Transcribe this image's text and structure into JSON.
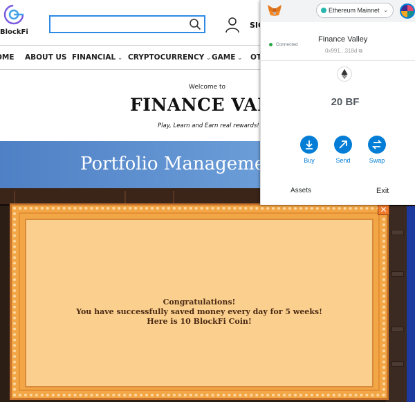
{
  "site": {
    "brand": "BlockFi",
    "search": {
      "value": "",
      "placeholder": ""
    },
    "sign_in_label": "SIG",
    "nav": [
      {
        "label": "OME",
        "chevron": false
      },
      {
        "label": "ABOUT US",
        "chevron": false
      },
      {
        "label": "FINANCIAL",
        "chevron": true
      },
      {
        "label": "CRYPTOCURRENCY",
        "chevron": true
      },
      {
        "label": "GAME",
        "chevron": true
      },
      {
        "label": "OT",
        "chevron": false
      }
    ],
    "welcome": "Welcome to",
    "title": "FINANCE VALL",
    "tagline": "Play, Learn and Earn real rewards!",
    "banner": "Portfolio Manageme"
  },
  "game": {
    "popup_lines": [
      "Congratulations!",
      "You have successfully saved money every day for 5 weeks!",
      "Here is 10 BlockFi Coin!"
    ],
    "close_label": "✕"
  },
  "wallet": {
    "network": "Ethereum Mainnet",
    "status": "Connected",
    "account_name": "Finance Valley",
    "account_address": "0x991...318d",
    "balance": "20 BF",
    "actions": [
      {
        "label": "Buy",
        "icon": "download-icon"
      },
      {
        "label": "Send",
        "icon": "arrow-up-right-icon"
      },
      {
        "label": "Swap",
        "icon": "swap-icon"
      }
    ],
    "tabs": {
      "assets": "Assets",
      "exit": "Exit"
    }
  },
  "colors": {
    "search_border": "#2d8be6",
    "banner": "#5a8cd0",
    "popup_orange": "#f3a646",
    "popup_inner": "#fbcf8d",
    "metamask_blue": "#037dd6"
  }
}
